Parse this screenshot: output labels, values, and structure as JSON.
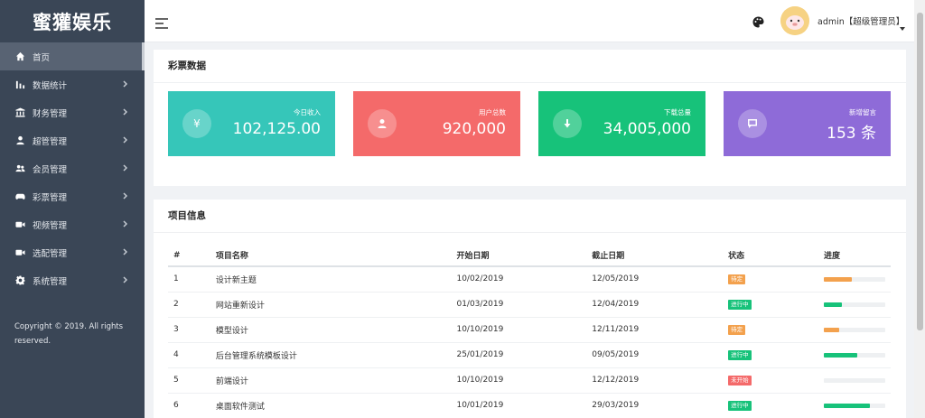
{
  "brand": "蜜獾娱乐",
  "sidebar": {
    "items": [
      {
        "label": "首页",
        "icon": "home-icon"
      },
      {
        "label": "数据统计",
        "icon": "bar-chart-icon"
      },
      {
        "label": "财务管理",
        "icon": "bank-icon"
      },
      {
        "label": "超管管理",
        "icon": "user-icon"
      },
      {
        "label": "会员管理",
        "icon": "users-icon"
      },
      {
        "label": "彩票管理",
        "icon": "gamepad-icon"
      },
      {
        "label": "视频管理",
        "icon": "video-icon"
      },
      {
        "label": "选配管理",
        "icon": "video-icon"
      },
      {
        "label": "系统管理",
        "icon": "gear-icon"
      }
    ],
    "copyright": "Copyright © 2019. All rights reserved."
  },
  "topbar": {
    "user": "admin【超级管理员】"
  },
  "lottery": {
    "title": "彩票数据",
    "cards": [
      {
        "label": "今日收入",
        "value": "102,125.00",
        "color": "#36c6b9",
        "icon": "yen-icon"
      },
      {
        "label": "用户总数",
        "value": "920,000",
        "color": "#f46a6a",
        "icon": "user-icon"
      },
      {
        "label": "下载总量",
        "value": "34,005,000",
        "color": "#17c27a",
        "icon": "download-icon"
      },
      {
        "label": "新增留言",
        "value": "153 条",
        "color": "#8e6bd8",
        "icon": "comment-icon"
      }
    ]
  },
  "projects": {
    "title": "项目信息",
    "headers": [
      "#",
      "项目名称",
      "开始日期",
      "截止日期",
      "状态",
      "进度"
    ],
    "rows": [
      {
        "id": "1",
        "name": "设计新主题",
        "start": "10/02/2019",
        "end": "12/05/2019",
        "status": "待定",
        "status_color": "#f3a14d",
        "progress": 45,
        "progress_color": "#f3a14d"
      },
      {
        "id": "2",
        "name": "网站重新设计",
        "start": "01/03/2019",
        "end": "12/04/2019",
        "status": "进行中",
        "status_color": "#17c27a",
        "progress": 30,
        "progress_color": "#17c27a"
      },
      {
        "id": "3",
        "name": "模型设计",
        "start": "10/10/2019",
        "end": "12/11/2019",
        "status": "待定",
        "status_color": "#f3a14d",
        "progress": 25,
        "progress_color": "#f3a14d"
      },
      {
        "id": "4",
        "name": "后台管理系统模板设计",
        "start": "25/01/2019",
        "end": "09/05/2019",
        "status": "进行中",
        "status_color": "#17c27a",
        "progress": 55,
        "progress_color": "#17c27a"
      },
      {
        "id": "5",
        "name": "前端设计",
        "start": "10/10/2019",
        "end": "12/12/2019",
        "status": "未开始",
        "status_color": "#f46a6a",
        "progress": 0,
        "progress_color": "#f46a6a"
      },
      {
        "id": "6",
        "name": "桌面软件测试",
        "start": "10/01/2019",
        "end": "29/03/2019",
        "status": "进行中",
        "status_color": "#17c27a",
        "progress": 75,
        "progress_color": "#17c27a"
      }
    ]
  }
}
